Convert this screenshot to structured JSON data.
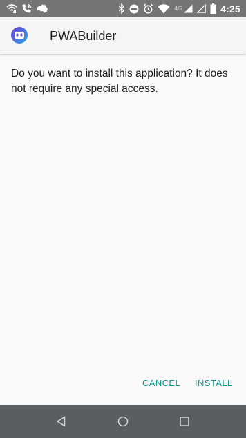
{
  "status_bar": {
    "time": "4:25",
    "network_type": "4G",
    "icons": [
      "wifi-call-icon",
      "phone-icon",
      "australia-icon",
      "bluetooth-icon",
      "do-not-disturb-icon",
      "alarm-icon",
      "wifi-icon",
      "signal-icon",
      "signal-empty-icon",
      "battery-icon"
    ]
  },
  "dialog": {
    "app_name": "PWABuilder",
    "message": "Do you want to install this application? It does not require any special access.",
    "cancel_label": "CANCEL",
    "install_label": "INSTALL"
  },
  "navigation": {
    "items": [
      "back-icon",
      "home-icon",
      "recents-icon"
    ]
  },
  "colors": {
    "accent": "#009688",
    "status_bar": "#757575",
    "nav_bar": "#5a5e63",
    "background": "#f9f9f9",
    "logo_gradient_start": "#6f3fd6",
    "logo_gradient_end": "#2ba3e8"
  }
}
